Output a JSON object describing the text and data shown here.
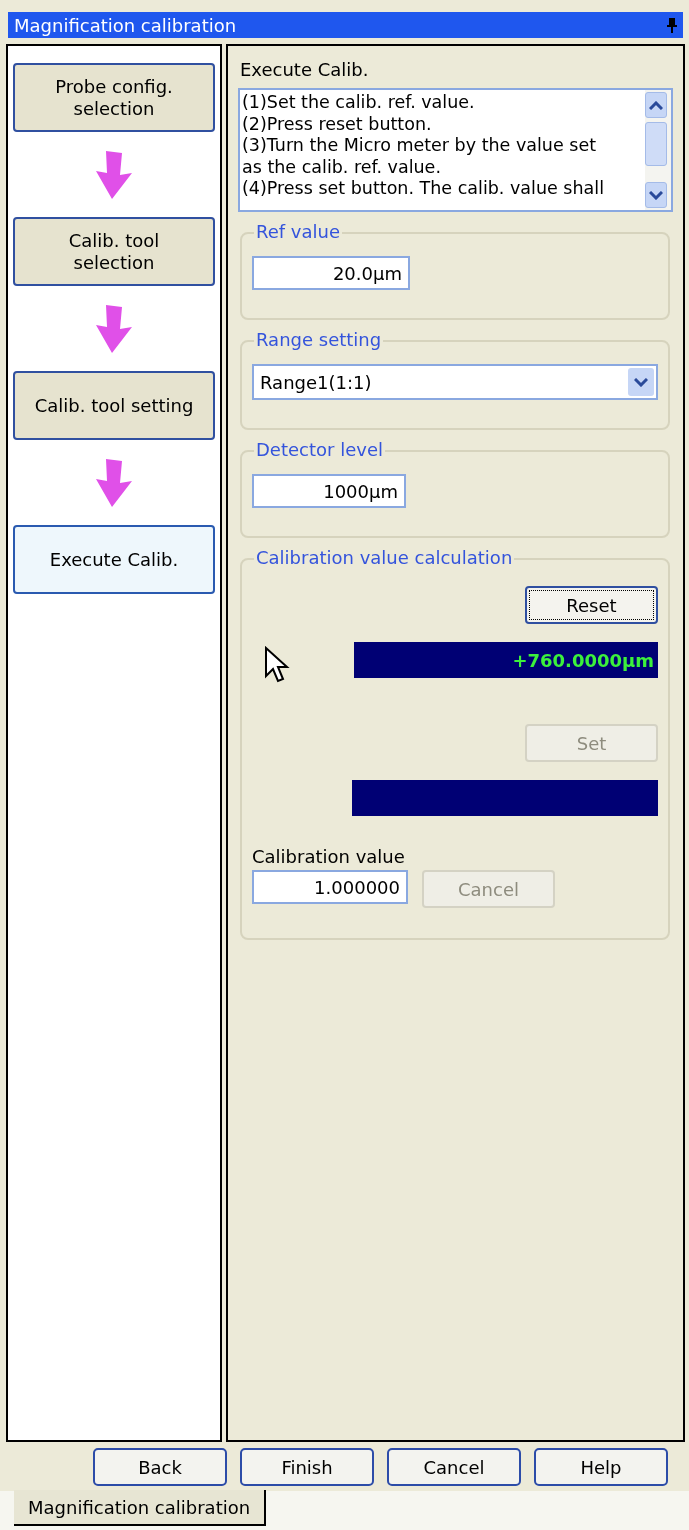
{
  "window": {
    "title": "Magnification calibration",
    "pinned": true
  },
  "steps": [
    {
      "label": "Probe config.\nselection",
      "selected": false
    },
    {
      "label": "Calib. tool\nselection",
      "selected": false
    },
    {
      "label": "Calib. tool setting",
      "selected": false
    },
    {
      "label": "Execute Calib.",
      "selected": true
    }
  ],
  "panel": {
    "heading": "Execute Calib.",
    "instructions": [
      "(1)Set the calib. ref. value.",
      "(2)Press reset button.",
      "(3)Turn the Micro meter by the value set",
      "as the calib. ref. value.",
      "(4)Press set button. The calib. value shall"
    ],
    "ref_value": {
      "label": "Ref value",
      "value": "20.0µm"
    },
    "range_setting": {
      "label": "Range setting",
      "value": "Range1(1:1)"
    },
    "detector_level": {
      "label": "Detector level",
      "value": "1000µm"
    },
    "calculation": {
      "label": "Calibration value calculation",
      "reset_button": {
        "label": "Reset",
        "disabled": false,
        "focused": true
      },
      "reading": "+760.0000µm",
      "set_button": {
        "label": "Set",
        "disabled": true
      },
      "value_label": "Calibration value",
      "value": "1.000000",
      "cancel_button": {
        "label": "Cancel",
        "disabled": true
      }
    }
  },
  "buttons": [
    {
      "label": "Back"
    },
    {
      "label": "Finish"
    },
    {
      "label": "Cancel"
    },
    {
      "label": "Help"
    }
  ],
  "tabs": [
    {
      "label": "Magnification calibration",
      "selected": true
    }
  ]
}
